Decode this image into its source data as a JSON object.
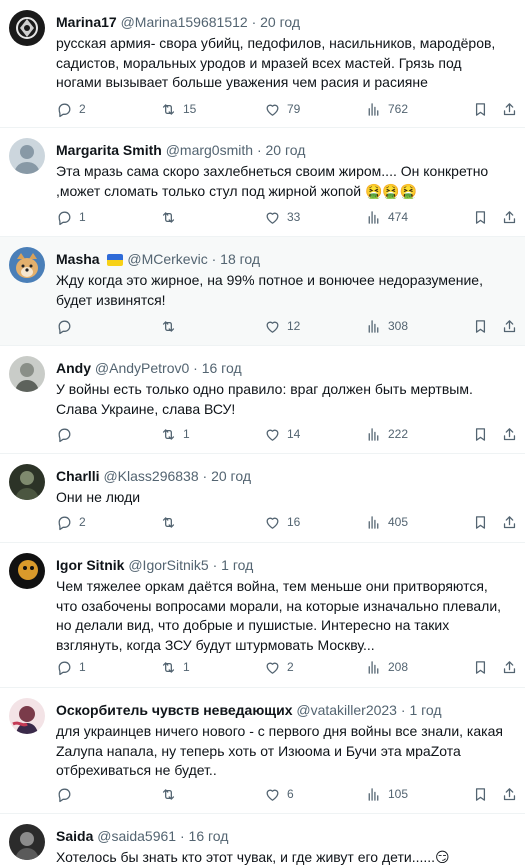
{
  "tweets": [
    {
      "name": "Marina17",
      "handle": "@Marina159681512",
      "time": "20 год",
      "text": "русская армия- свора убийц, педофилов, насильников, мародёров, садистов, моральных уродов и мразей всех мастей. Грязь под ногами вызывает больше уважения чем расия и расияне",
      "emoji": "",
      "replies": "2",
      "retweets": "15",
      "likes": "79",
      "views": "762",
      "avatar_icon": "profile-photo-icon"
    },
    {
      "name": "Margarita Smith",
      "handle": "@marg0smith",
      "time": "20 год",
      "text": "Эта мразь сама скоро захлебнеться своим жиром.... Он конкретно ,может сломать только стул под жирной жопой",
      "emoji": "🤮🤮🤮",
      "replies": "1",
      "retweets": "",
      "likes": "33",
      "views": "474",
      "avatar_icon": "default-profile-icon"
    },
    {
      "name": "Masha",
      "flag": "ukraine-flag-icon",
      "handle": "@MCerkevic",
      "time": "18 год",
      "text": "Жду когда это жирное, на 99% потное и вонючее недоразумение, будет извинятся!",
      "emoji": "",
      "replies": "",
      "retweets": "",
      "likes": "12",
      "views": "308",
      "avatar_icon": "dog-photo-icon"
    },
    {
      "name": "Andy",
      "handle": "@AndyPetrov0",
      "time": "16 год",
      "text": "У войны есть только одно правило: враг должен быть мертвым. Слава Украине, слава ВСУ!",
      "emoji": "",
      "replies": "",
      "retweets": "1",
      "likes": "14",
      "views": "222",
      "avatar_icon": "profile-photo-icon"
    },
    {
      "name": "Charlli",
      "handle": "@Klass296838",
      "time": "20 год",
      "text": "Они не люди",
      "emoji": "",
      "replies": "2",
      "retweets": "",
      "likes": "16",
      "views": "405",
      "avatar_icon": "profile-photo-icon"
    },
    {
      "name": "Igor Sitnik",
      "handle": "@IgorSitnik5",
      "time": "1 год",
      "text": "Чем тяжелее оркам даётся война, тем меньше они притворяются, что озабочены вопросами морали, на которые изначально плевали, но делали вид, что добрые и пушистые. Интересно на таких взглянуть, когда ЗСУ будут штурмовать Москву...",
      "emoji": "",
      "replies": "1",
      "retweets": "1",
      "likes": "2",
      "views": "208",
      "avatar_icon": "profile-photo-icon"
    },
    {
      "name": "Оскорбитель чувств неведающих",
      "handle": "@vatakiller2023",
      "time": "1 год",
      "text": "для украинцев ничего нового - с первого дня войны все знали, какая Zалупа напала, ну теперь хоть от Изюома и Бучи эта мраZота отбрехиваться не будет..",
      "emoji": "",
      "replies": "",
      "retweets": "",
      "likes": "6",
      "views": "105",
      "avatar_icon": "profile-photo-icon"
    },
    {
      "name": "Saida",
      "handle": "@saida5961",
      "time": "16 год",
      "text": "Хотелось бы знать кто этот чувак, и где живут его дети......",
      "emoji": "😏",
      "replies": "",
      "retweets": "",
      "likes": "",
      "views": "",
      "avatar_icon": "profile-photo-icon"
    }
  ],
  "separator": "·",
  "colors": {
    "text": "#0f1419",
    "secondary": "#536471",
    "border": "#eff3f4",
    "highlight": "#f7f9f9"
  }
}
